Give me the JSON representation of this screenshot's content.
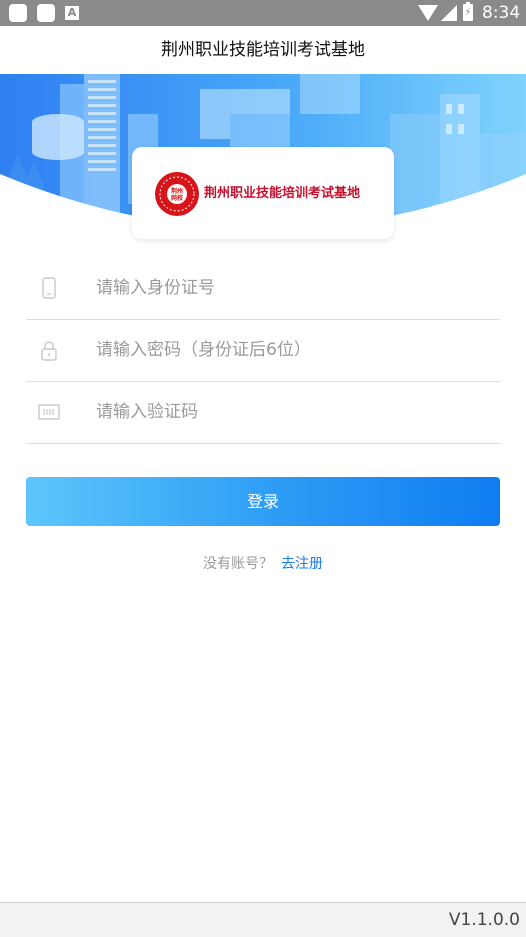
{
  "status_bar": {
    "time": "8:34",
    "notification_icon_letter": "A",
    "icons": [
      "app-square-icon",
      "app-square-icon",
      "a-notification-icon",
      "wifi-icon",
      "signal-icon",
      "battery-charging-icon"
    ]
  },
  "header": {
    "title": "荆州职业技能培训考试基地"
  },
  "banner": {
    "logo_text": "荆州职业技能培训考试基地",
    "seal_text": "荆州网校",
    "seal_color": "#d7141a"
  },
  "form": {
    "id_number": {
      "placeholder": "请输入身份证号",
      "value": "",
      "icon": "phone-icon"
    },
    "password": {
      "placeholder": "请输入密码（身份证后6位）",
      "value": "",
      "icon": "lock-icon"
    },
    "captcha": {
      "placeholder": "请输入验证码",
      "value": "",
      "icon": "barcode-icon"
    },
    "login_label": "登录"
  },
  "register": {
    "prompt": "没有账号？",
    "link": "去注册"
  },
  "footer": {
    "version": "V1.1.0.0"
  },
  "colors": {
    "primary": "#1a7be0",
    "button_gradient_start": "#5cc6fb",
    "button_gradient_end": "#0f7cf1",
    "status_bar": "#8a8a8a"
  }
}
